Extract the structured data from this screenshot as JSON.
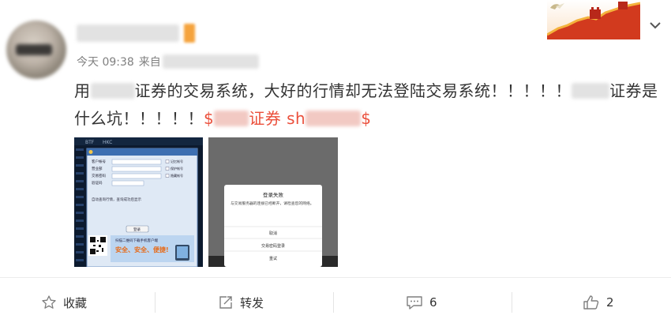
{
  "post": {
    "time": "今天 09:38",
    "source_prefix": "来自",
    "text_line1_a": "用",
    "text_line1_b": "证券的交易系统，大好的行情却无法登陆交易系统！！！！！",
    "text_line1_c": "证券是",
    "text_line2_a": "什么坑！！！！！",
    "topic_start": "$",
    "topic_mid": "证券 sh",
    "topic_end": "$"
  },
  "image1": {
    "tabs": [
      "BTF",
      "HKC"
    ],
    "fields": [
      "客户帐号",
      "营业部",
      "交易密码",
      "验证码"
    ],
    "checks": [
      "记忆帐号",
      "保护帐号",
      "隐藏帐号"
    ],
    "notice": "自动查询行情，查询成功后显示",
    "login_button": "登录",
    "promo_title": "安全、安全、便捷!",
    "promo_sub": "扫描二维码下载手机客户端"
  },
  "image2": {
    "dialog_title": "登录失败",
    "dialog_message": "与交易服务器的连接已经断开，请检查您的网络。",
    "options": [
      "取消",
      "交易密码登录",
      "重试"
    ]
  },
  "actions": {
    "favorite_label": "收藏",
    "repost_label": "转发",
    "comment_count": "6",
    "like_count": "2"
  },
  "colors": {
    "topic_red": "#eb4f3b",
    "muted_gray": "#808080",
    "text": "#333333"
  }
}
